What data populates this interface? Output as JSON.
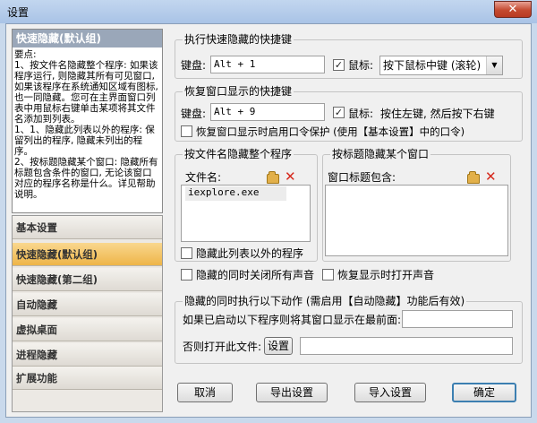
{
  "window": {
    "title": "设置",
    "close_glyph": "✕"
  },
  "help": {
    "header": "快速隐藏(默认组)",
    "text": "要点:\n1、按文件名隐藏整个程序: 如果该程序运行, 则隐藏其所有可见窗口, 如果该程序在系统通知区域有图标, 也一同隐藏。您可在主界面窗口列表中用鼠标右键单击某项将其文件名添加到列表。\n1、1、隐藏此列表以外的程序: 保留列出的程序, 隐藏未列出的程序。\n2、按标题隐藏某个窗口: 隐藏所有标题包含条件的窗口, 无论该窗口对应的程序名称是什么。详见帮助说明。"
  },
  "nav": {
    "items": [
      {
        "label": "基本设置",
        "active": false
      },
      {
        "label": "快速隐藏(默认组)",
        "active": true
      },
      {
        "label": "快速隐藏(第二组)",
        "active": false
      },
      {
        "label": "自动隐藏",
        "active": false
      },
      {
        "label": "虚拟桌面",
        "active": false
      },
      {
        "label": "进程隐藏",
        "active": false
      },
      {
        "label": "扩展功能",
        "active": false
      }
    ]
  },
  "hotkey_hide": {
    "group_title": "执行快速隐藏的快捷键",
    "keyboard_label": "键盘:",
    "keyboard_value": "Alt + 1",
    "mouse_checked": true,
    "mouse_label": "鼠标:",
    "mouse_select": "按下鼠标中键 (滚轮)"
  },
  "hotkey_restore": {
    "group_title": "恢复窗口显示的快捷键",
    "keyboard_label": "键盘:",
    "keyboard_value": "Alt + 9",
    "mouse_checked": true,
    "mouse_label": "鼠标:",
    "mouse_text": "按住左键, 然后按下右键",
    "password_checked": false,
    "password_label": "恢复窗口显示时启用口令保护 (使用【基本设置】中的口令)"
  },
  "hide_by_file": {
    "group_title": "按文件名隐藏整个程序",
    "list_header": "文件名:",
    "items": [
      "iexplore.exe"
    ],
    "hide_others_checked": false,
    "hide_others_label": "隐藏此列表以外的程序"
  },
  "hide_by_title": {
    "group_title": "按标题隐藏某个窗口",
    "list_header": "窗口标题包含:",
    "items": []
  },
  "options": {
    "mute_label": "隐藏的同时关闭所有声音",
    "mute_checked": false,
    "sound_label": "恢复显示时打开声音",
    "sound_checked": false
  },
  "actions": {
    "group_title": "隐藏的同时执行以下动作 (需启用【自动隐藏】功能后有效)",
    "front_label": "如果已启动以下程序则将其窗口显示在最前面:",
    "front_value": "",
    "open_label": "否则打开此文件:",
    "settings_button": "设置",
    "open_value": ""
  },
  "footer": {
    "cancel": "取消",
    "export": "导出设置",
    "import": "导入设置",
    "ok": "确定"
  }
}
